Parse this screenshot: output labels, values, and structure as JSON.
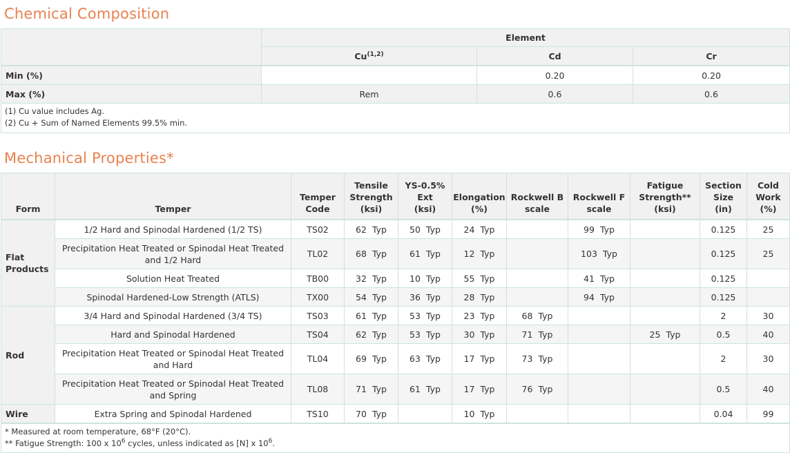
{
  "chemical": {
    "title": "Chemical Composition",
    "group_header": "Element",
    "elements": [
      {
        "symbol": "Cu",
        "sup": "(1,2)"
      },
      {
        "symbol": "Cd",
        "sup": ""
      },
      {
        "symbol": "Cr",
        "sup": ""
      }
    ],
    "rows": [
      {
        "label": "Min (%)",
        "values": [
          "",
          "0.20",
          "0.20"
        ]
      },
      {
        "label": "Max (%)",
        "values": [
          "Rem",
          "0.6",
          "0.6"
        ]
      }
    ],
    "notes": [
      "(1) Cu value includes Ag.",
      "(2) Cu + Sum of Named Elements 99.5% min."
    ]
  },
  "mechanical": {
    "title": "Mechanical Properties*",
    "headers": {
      "form": "Form",
      "temper": "Temper",
      "temper_code": [
        "Temper",
        "Code"
      ],
      "tensile": [
        "Tensile",
        "Strength",
        "(ksi)"
      ],
      "ys": [
        "YS-0.5%",
        "Ext",
        "(ksi)"
      ],
      "elongation": [
        "Elongation",
        "(%)"
      ],
      "rockwell_b": [
        "Rockwell B",
        "scale"
      ],
      "rockwell_f": [
        "Rockwell F",
        "scale"
      ],
      "fatigue": [
        "Fatigue",
        "Strength**",
        "(ksi)"
      ],
      "section": [
        "Section",
        "Size",
        "(in)"
      ],
      "cold_work": [
        "Cold",
        "Work",
        "(%)"
      ]
    },
    "typ_label": "Typ",
    "forms": {
      "flat": [
        "Flat",
        "Products"
      ],
      "rod": "Rod",
      "wire": "Wire"
    },
    "rows": [
      {
        "temper": "1/2 Hard and Spinodal Hardened (1/2 TS)",
        "code": "TS02",
        "tensile": "62",
        "ys": "50",
        "elong": "24",
        "rb": "",
        "rf": "99",
        "fatigue": "",
        "section": "0.125",
        "cold": "25"
      },
      {
        "temper": "Precipitation Heat Treated or Spinodal Heat Treated and 1/2 Hard",
        "code": "TL02",
        "tensile": "68",
        "ys": "61",
        "elong": "12",
        "rb": "",
        "rf": "103",
        "fatigue": "",
        "section": "0.125",
        "cold": "25"
      },
      {
        "temper": "Solution Heat Treated",
        "code": "TB00",
        "tensile": "32",
        "ys": "10",
        "elong": "55",
        "rb": "",
        "rf": "41",
        "fatigue": "",
        "section": "0.125",
        "cold": ""
      },
      {
        "temper": "Spinodal Hardened-Low Strength (ATLS)",
        "code": "TX00",
        "tensile": "54",
        "ys": "36",
        "elong": "28",
        "rb": "",
        "rf": "94",
        "fatigue": "",
        "section": "0.125",
        "cold": ""
      },
      {
        "temper": "3/4 Hard and Spinodal Hardened (3/4 TS)",
        "code": "TS03",
        "tensile": "61",
        "ys": "53",
        "elong": "23",
        "rb": "68",
        "rf": "",
        "fatigue": "",
        "section": "2",
        "cold": "30"
      },
      {
        "temper": "Hard and Spinodal Hardened",
        "code": "TS04",
        "tensile": "62",
        "ys": "53",
        "elong": "30",
        "rb": "71",
        "rf": "",
        "fatigue": "25",
        "section": "0.5",
        "cold": "40"
      },
      {
        "temper": "Precipitation Heat Treated or Spinodal Heat Treated and Hard",
        "code": "TL04",
        "tensile": "69",
        "ys": "63",
        "elong": "17",
        "rb": "73",
        "rf": "",
        "fatigue": "",
        "section": "2",
        "cold": "30"
      },
      {
        "temper": "Precipitation Heat Treated or Spinodal Heat Treated and Spring",
        "code": "TL08",
        "tensile": "71",
        "ys": "61",
        "elong": "17",
        "rb": "76",
        "rf": "",
        "fatigue": "",
        "section": "0.5",
        "cold": "40"
      },
      {
        "temper": "Extra Spring and Spinodal Hardened",
        "code": "TS10",
        "tensile": "70",
        "ys": "",
        "elong": "10",
        "rb": "",
        "rf": "",
        "fatigue": "",
        "section": "0.04",
        "cold": "99"
      }
    ],
    "notes": {
      "note1": "* Measured at room temperature, 68°F (20°C).",
      "note2_a": "** Fatigue Strength: 100 x 10",
      "note2_sup1": "6",
      "note2_b": " cycles, unless indicated as [N] x 10",
      "note2_sup2": "6",
      "note2_c": "."
    }
  }
}
